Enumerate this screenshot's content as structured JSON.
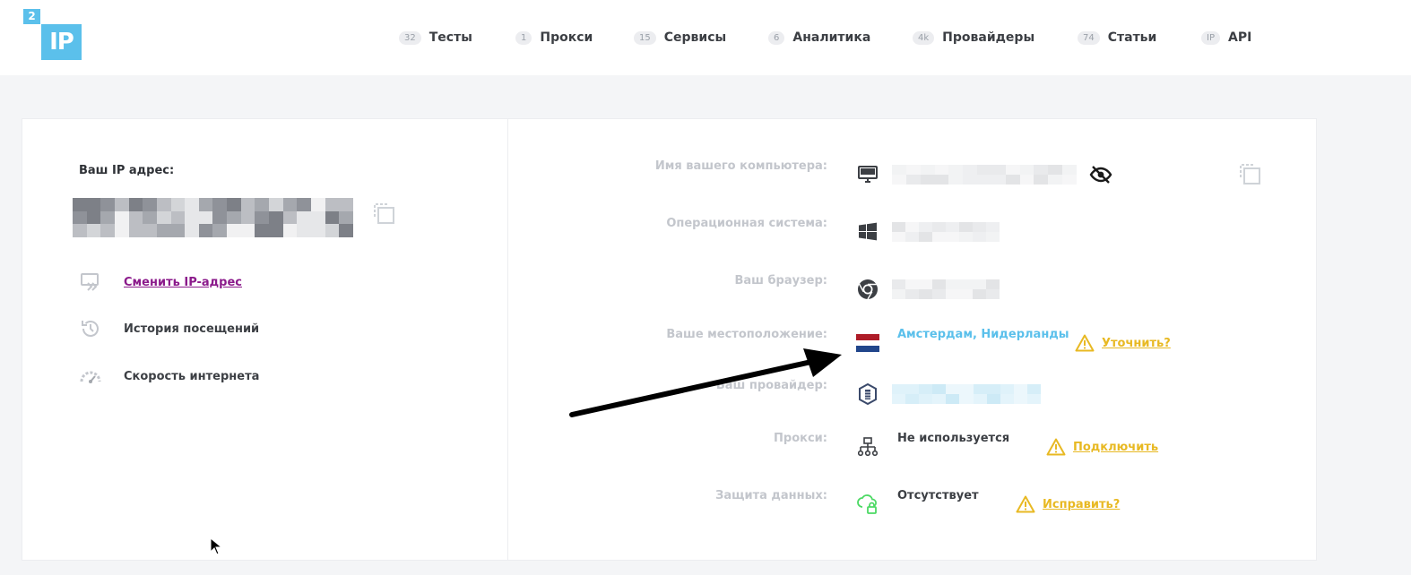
{
  "logo": {
    "small": "2",
    "big": "IP"
  },
  "nav": [
    {
      "badge": "32",
      "label": "Тесты"
    },
    {
      "badge": "1",
      "label": "Прокси"
    },
    {
      "badge": "15",
      "label": "Сервисы"
    },
    {
      "badge": "6",
      "label": "Аналитика"
    },
    {
      "badge": "4k",
      "label": "Провайдеры"
    },
    {
      "badge": "74",
      "label": "Статьи"
    },
    {
      "badge": "IP",
      "label": "API"
    }
  ],
  "left": {
    "ip_title": "Ваш IP адрес:",
    "links": [
      {
        "label": "Сменить IP-адрес",
        "icon": "change-ip-icon"
      },
      {
        "label": "История посещений",
        "icon": "history-icon"
      },
      {
        "label": "Скорость интернета",
        "icon": "speedometer-icon"
      }
    ]
  },
  "rows": {
    "computer": {
      "label": "Имя вашего компьютера:",
      "icon": "monitor-icon"
    },
    "os": {
      "label": "Операционная система:",
      "icon": "windows-icon"
    },
    "browser": {
      "label": "Ваш браузер:",
      "icon": "chrome-icon"
    },
    "location": {
      "label": "Ваше местоположение:",
      "icon": "netherlands-flag-icon",
      "value": "Амстердам, Нидерланды",
      "action": "Уточнить?"
    },
    "provider": {
      "label": "Ваш провайдер:",
      "icon": "provider-shield-icon"
    },
    "proxy": {
      "label": "Прокси:",
      "icon": "network-icon",
      "value": "Не используется",
      "action": "Подключить"
    },
    "protection": {
      "label": "Защита данных:",
      "icon": "cloud-lock-icon",
      "value": "Отсутствует",
      "action": "Исправить?"
    }
  },
  "colors": {
    "accent": "#5bc0eb",
    "warning": "#e8b923",
    "link_visited": "#8b1a8b",
    "label_muted": "#c3c6cc",
    "text_dark": "#3c3f44"
  }
}
